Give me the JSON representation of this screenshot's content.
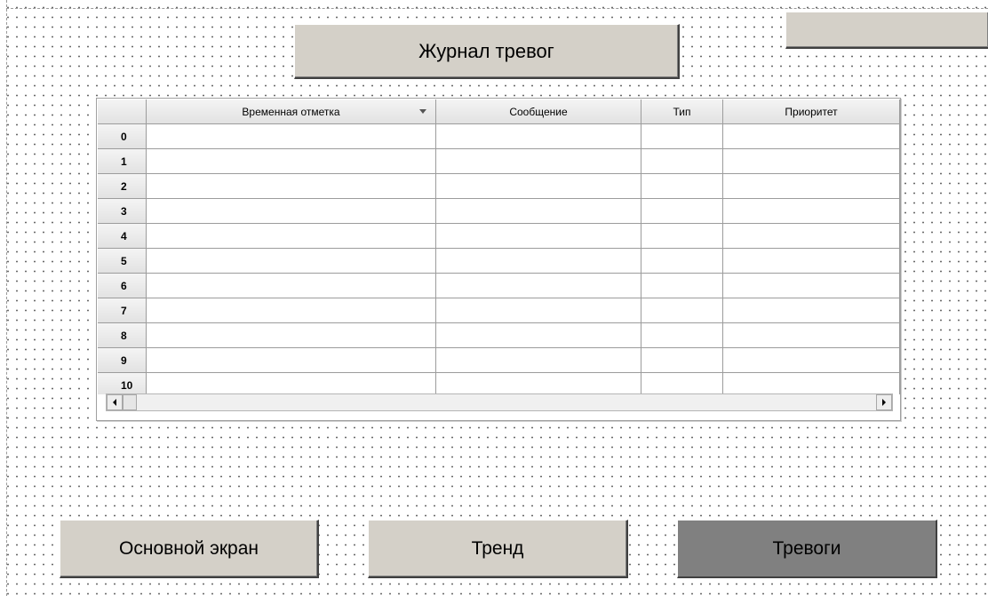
{
  "title_button": {
    "label": "Журнал тревог"
  },
  "corner_button": {
    "label": ""
  },
  "alarm_table": {
    "columns": [
      "",
      "Временная отметка",
      "Сообщение",
      "Тип",
      "Приоритет"
    ],
    "sorted_column": "Временная отметка",
    "rows": [
      {
        "index": "0",
        "cells": [
          "",
          "",
          "",
          ""
        ]
      },
      {
        "index": "1",
        "cells": [
          "",
          "",
          "",
          ""
        ]
      },
      {
        "index": "2",
        "cells": [
          "",
          "",
          "",
          ""
        ]
      },
      {
        "index": "3",
        "cells": [
          "",
          "",
          "",
          ""
        ]
      },
      {
        "index": "4",
        "cells": [
          "",
          "",
          "",
          ""
        ]
      },
      {
        "index": "5",
        "cells": [
          "",
          "",
          "",
          ""
        ]
      },
      {
        "index": "6",
        "cells": [
          "",
          "",
          "",
          ""
        ]
      },
      {
        "index": "7",
        "cells": [
          "",
          "",
          "",
          ""
        ]
      },
      {
        "index": "8",
        "cells": [
          "",
          "",
          "",
          ""
        ]
      },
      {
        "index": "9",
        "cells": [
          "",
          "",
          "",
          ""
        ]
      },
      {
        "index": "10",
        "cells": [
          "",
          "",
          "",
          ""
        ]
      }
    ],
    "scrollbar": {
      "left_icon": "arrow-left-icon",
      "right_icon": "arrow-right-icon",
      "position": 0
    }
  },
  "nav": {
    "buttons": [
      {
        "label": "Основной экран",
        "active": false
      },
      {
        "label": "Тренд",
        "active": false
      },
      {
        "label": "Тревоги",
        "active": true
      }
    ]
  },
  "colors": {
    "button_face": "#d4d0c8",
    "button_active": "#808080",
    "grid_line": "#9c9c9c",
    "header_bg": "#e8e8e8"
  }
}
